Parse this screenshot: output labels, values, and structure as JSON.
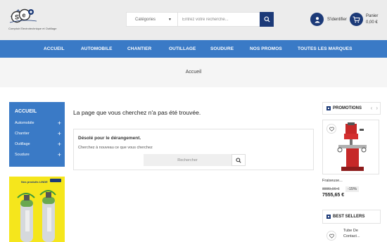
{
  "header": {
    "logo_tagline": "Comptoir Electrotechnique et Outillage",
    "category_select": "Catégories",
    "search_placeholder": "Entrez votre recherche...",
    "account_label": "S'identifier",
    "cart_label": "Panier",
    "cart_total": "0,00 €"
  },
  "nav": {
    "items": [
      {
        "label": "ACCUEIL"
      },
      {
        "label": "AUTOMOBILE"
      },
      {
        "label": "CHANTIER"
      },
      {
        "label": "OUTILLAGE"
      },
      {
        "label": "SOUDURE"
      },
      {
        "label": "NOS PROMOS"
      },
      {
        "label": "TOUTES LES MARQUES"
      }
    ]
  },
  "breadcrumb": {
    "current": "Accueil"
  },
  "sidebar": {
    "title": "ACCUEIL",
    "items": [
      {
        "label": "Automobile"
      },
      {
        "label": "Chantier"
      },
      {
        "label": "Outillage"
      },
      {
        "label": "Soudure"
      }
    ]
  },
  "banner": {
    "headline": "Nos produits LINDE"
  },
  "main": {
    "title": "La page que vous cherchez n'a pas été trouvée.",
    "sorry": "Désolé pour le dérangement.",
    "retry": "Cherchez à nouveau ce que vous cherchez",
    "search_placeholder": "Rechercher"
  },
  "promotions": {
    "title": "PROMOTIONS",
    "product": {
      "name": "Fraiseuse...",
      "old_price": "8889,00 €",
      "discount": "-15%",
      "price": "7555,65 €"
    }
  },
  "bestsellers": {
    "title": "BEST SELLERS",
    "item": {
      "name_line1": "Tube De",
      "name_line2": "Contact..."
    }
  },
  "colors": {
    "brand_navy": "#1c3a78",
    "nav_blue": "#3a7ac6",
    "banner_yellow": "#f5e61c"
  }
}
